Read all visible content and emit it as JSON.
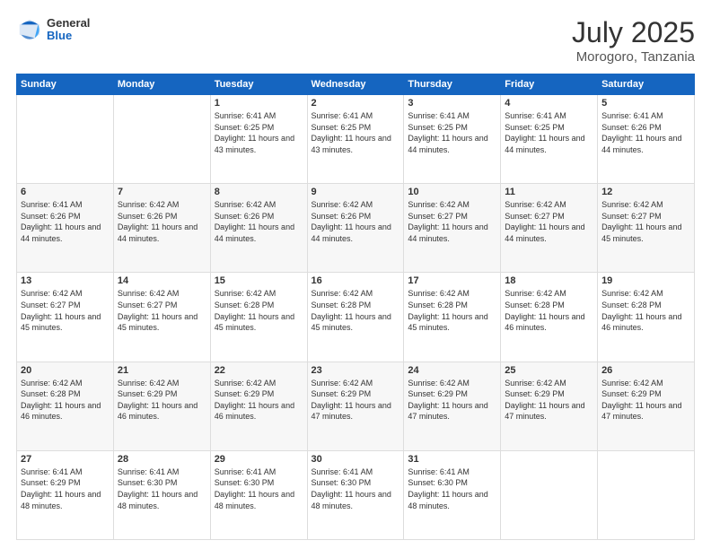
{
  "header": {
    "logo": {
      "general": "General",
      "blue": "Blue"
    },
    "title": "July 2025",
    "subtitle": "Morogoro, Tanzania"
  },
  "weekdays": [
    "Sunday",
    "Monday",
    "Tuesday",
    "Wednesday",
    "Thursday",
    "Friday",
    "Saturday"
  ],
  "weeks": [
    [
      {
        "day": "",
        "sunrise": "",
        "sunset": "",
        "daylight": ""
      },
      {
        "day": "",
        "sunrise": "",
        "sunset": "",
        "daylight": ""
      },
      {
        "day": "1",
        "sunrise": "Sunrise: 6:41 AM",
        "sunset": "Sunset: 6:25 PM",
        "daylight": "Daylight: 11 hours and 43 minutes."
      },
      {
        "day": "2",
        "sunrise": "Sunrise: 6:41 AM",
        "sunset": "Sunset: 6:25 PM",
        "daylight": "Daylight: 11 hours and 43 minutes."
      },
      {
        "day": "3",
        "sunrise": "Sunrise: 6:41 AM",
        "sunset": "Sunset: 6:25 PM",
        "daylight": "Daylight: 11 hours and 44 minutes."
      },
      {
        "day": "4",
        "sunrise": "Sunrise: 6:41 AM",
        "sunset": "Sunset: 6:25 PM",
        "daylight": "Daylight: 11 hours and 44 minutes."
      },
      {
        "day": "5",
        "sunrise": "Sunrise: 6:41 AM",
        "sunset": "Sunset: 6:26 PM",
        "daylight": "Daylight: 11 hours and 44 minutes."
      }
    ],
    [
      {
        "day": "6",
        "sunrise": "Sunrise: 6:41 AM",
        "sunset": "Sunset: 6:26 PM",
        "daylight": "Daylight: 11 hours and 44 minutes."
      },
      {
        "day": "7",
        "sunrise": "Sunrise: 6:42 AM",
        "sunset": "Sunset: 6:26 PM",
        "daylight": "Daylight: 11 hours and 44 minutes."
      },
      {
        "day": "8",
        "sunrise": "Sunrise: 6:42 AM",
        "sunset": "Sunset: 6:26 PM",
        "daylight": "Daylight: 11 hours and 44 minutes."
      },
      {
        "day": "9",
        "sunrise": "Sunrise: 6:42 AM",
        "sunset": "Sunset: 6:26 PM",
        "daylight": "Daylight: 11 hours and 44 minutes."
      },
      {
        "day": "10",
        "sunrise": "Sunrise: 6:42 AM",
        "sunset": "Sunset: 6:27 PM",
        "daylight": "Daylight: 11 hours and 44 minutes."
      },
      {
        "day": "11",
        "sunrise": "Sunrise: 6:42 AM",
        "sunset": "Sunset: 6:27 PM",
        "daylight": "Daylight: 11 hours and 44 minutes."
      },
      {
        "day": "12",
        "sunrise": "Sunrise: 6:42 AM",
        "sunset": "Sunset: 6:27 PM",
        "daylight": "Daylight: 11 hours and 45 minutes."
      }
    ],
    [
      {
        "day": "13",
        "sunrise": "Sunrise: 6:42 AM",
        "sunset": "Sunset: 6:27 PM",
        "daylight": "Daylight: 11 hours and 45 minutes."
      },
      {
        "day": "14",
        "sunrise": "Sunrise: 6:42 AM",
        "sunset": "Sunset: 6:27 PM",
        "daylight": "Daylight: 11 hours and 45 minutes."
      },
      {
        "day": "15",
        "sunrise": "Sunrise: 6:42 AM",
        "sunset": "Sunset: 6:28 PM",
        "daylight": "Daylight: 11 hours and 45 minutes."
      },
      {
        "day": "16",
        "sunrise": "Sunrise: 6:42 AM",
        "sunset": "Sunset: 6:28 PM",
        "daylight": "Daylight: 11 hours and 45 minutes."
      },
      {
        "day": "17",
        "sunrise": "Sunrise: 6:42 AM",
        "sunset": "Sunset: 6:28 PM",
        "daylight": "Daylight: 11 hours and 45 minutes."
      },
      {
        "day": "18",
        "sunrise": "Sunrise: 6:42 AM",
        "sunset": "Sunset: 6:28 PM",
        "daylight": "Daylight: 11 hours and 46 minutes."
      },
      {
        "day": "19",
        "sunrise": "Sunrise: 6:42 AM",
        "sunset": "Sunset: 6:28 PM",
        "daylight": "Daylight: 11 hours and 46 minutes."
      }
    ],
    [
      {
        "day": "20",
        "sunrise": "Sunrise: 6:42 AM",
        "sunset": "Sunset: 6:28 PM",
        "daylight": "Daylight: 11 hours and 46 minutes."
      },
      {
        "day": "21",
        "sunrise": "Sunrise: 6:42 AM",
        "sunset": "Sunset: 6:29 PM",
        "daylight": "Daylight: 11 hours and 46 minutes."
      },
      {
        "day": "22",
        "sunrise": "Sunrise: 6:42 AM",
        "sunset": "Sunset: 6:29 PM",
        "daylight": "Daylight: 11 hours and 46 minutes."
      },
      {
        "day": "23",
        "sunrise": "Sunrise: 6:42 AM",
        "sunset": "Sunset: 6:29 PM",
        "daylight": "Daylight: 11 hours and 47 minutes."
      },
      {
        "day": "24",
        "sunrise": "Sunrise: 6:42 AM",
        "sunset": "Sunset: 6:29 PM",
        "daylight": "Daylight: 11 hours and 47 minutes."
      },
      {
        "day": "25",
        "sunrise": "Sunrise: 6:42 AM",
        "sunset": "Sunset: 6:29 PM",
        "daylight": "Daylight: 11 hours and 47 minutes."
      },
      {
        "day": "26",
        "sunrise": "Sunrise: 6:42 AM",
        "sunset": "Sunset: 6:29 PM",
        "daylight": "Daylight: 11 hours and 47 minutes."
      }
    ],
    [
      {
        "day": "27",
        "sunrise": "Sunrise: 6:41 AM",
        "sunset": "Sunset: 6:29 PM",
        "daylight": "Daylight: 11 hours and 48 minutes."
      },
      {
        "day": "28",
        "sunrise": "Sunrise: 6:41 AM",
        "sunset": "Sunset: 6:30 PM",
        "daylight": "Daylight: 11 hours and 48 minutes."
      },
      {
        "day": "29",
        "sunrise": "Sunrise: 6:41 AM",
        "sunset": "Sunset: 6:30 PM",
        "daylight": "Daylight: 11 hours and 48 minutes."
      },
      {
        "day": "30",
        "sunrise": "Sunrise: 6:41 AM",
        "sunset": "Sunset: 6:30 PM",
        "daylight": "Daylight: 11 hours and 48 minutes."
      },
      {
        "day": "31",
        "sunrise": "Sunrise: 6:41 AM",
        "sunset": "Sunset: 6:30 PM",
        "daylight": "Daylight: 11 hours and 48 minutes."
      },
      {
        "day": "",
        "sunrise": "",
        "sunset": "",
        "daylight": ""
      },
      {
        "day": "",
        "sunrise": "",
        "sunset": "",
        "daylight": ""
      }
    ]
  ]
}
